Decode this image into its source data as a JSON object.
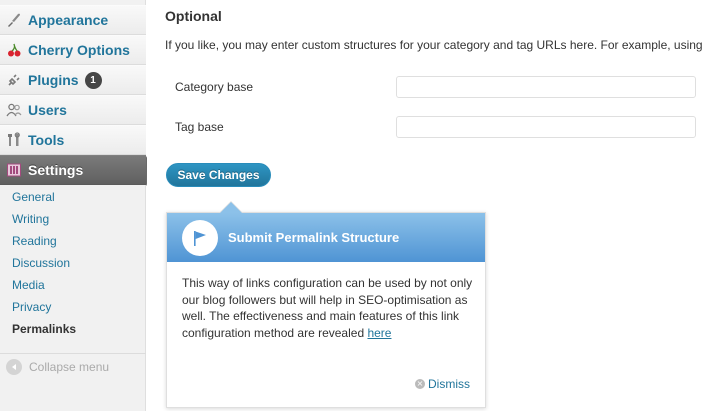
{
  "sidebar": {
    "menu": [
      {
        "label": "Appearance",
        "icon": "appearance-icon"
      },
      {
        "label": "Cherry Options",
        "icon": "cherry-icon"
      },
      {
        "label": "Plugins",
        "icon": "plugin-icon",
        "badge": "1"
      },
      {
        "label": "Users",
        "icon": "users-icon"
      },
      {
        "label": "Tools",
        "icon": "tools-icon"
      },
      {
        "label": "Settings",
        "icon": "settings-icon",
        "active": true
      }
    ],
    "submenu": [
      "General",
      "Writing",
      "Reading",
      "Discussion",
      "Media",
      "Privacy",
      "Permalinks"
    ],
    "current_submenu": "Permalinks",
    "collapse_label": "Collapse menu"
  },
  "main": {
    "section_title": "Optional",
    "intro_prefix": "If you like, you may enter custom structures for your category and tag ",
    "intro_abbr": "URLs",
    "intro_suffix": " here. For example, using",
    "fields": [
      {
        "label": "Category base",
        "value": "",
        "placeholder": ""
      },
      {
        "label": "Tag base",
        "value": "",
        "placeholder": ""
      }
    ],
    "save_label": "Save Changes"
  },
  "pointer": {
    "title": "Submit Permalink Structure",
    "body": "This way of links configuration can be used by not only our blog followers but will help in SEO-optimisation as well. The effectiveness and main features of this link configuration method are revealed ",
    "link_label": "here",
    "dismiss_label": "Dismiss"
  },
  "colors": {
    "link": "#21759b",
    "active_menu": "#6a6a6a",
    "button": "#21759b",
    "pointer_header_top": "#8cc1e9",
    "pointer_header_bottom": "#4f94d4"
  }
}
